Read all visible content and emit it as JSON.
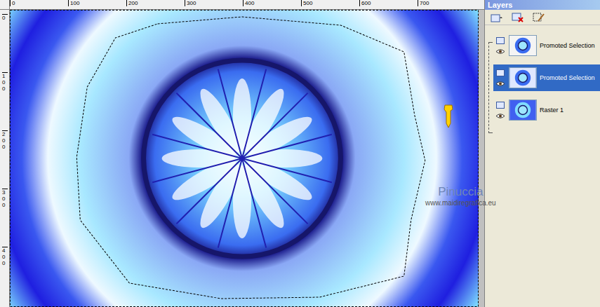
{
  "canvas": {
    "ruler_top": [
      "0",
      "100",
      "200",
      "300",
      "400",
      "500",
      "600",
      "700"
    ],
    "ruler_left": [
      "0",
      "100",
      "200",
      "300",
      "400"
    ],
    "watermark": {
      "title": "Pinuccia",
      "url": "www.maidiregrafica.eu"
    }
  },
  "layers_panel": {
    "title": "Layers",
    "layers": [
      {
        "name": "Promoted Selection",
        "selected": false,
        "visible": true
      },
      {
        "name": "Promoted Selection",
        "selected": true,
        "visible": true
      },
      {
        "name": "Raster 1",
        "selected": false,
        "visible": true
      }
    ]
  }
}
